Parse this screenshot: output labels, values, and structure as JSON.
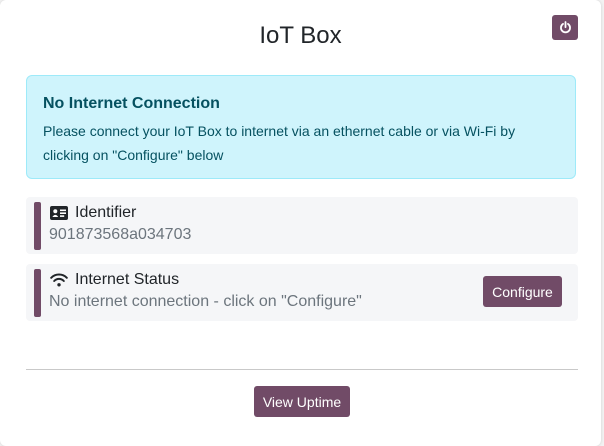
{
  "header": {
    "title": "IoT Box",
    "power_icon": "power-icon"
  },
  "alert": {
    "heading": "No Internet Connection",
    "body": "Please connect your IoT Box to internet via an ethernet cable or via Wi-Fi by clicking on \"Configure\" below"
  },
  "identifier": {
    "icon": "id-card-icon",
    "label": "Identifier",
    "value": "901873568a034703"
  },
  "internet_status": {
    "icon": "wifi-icon",
    "label": "Internet Status",
    "value": "No internet connection - click on \"Configure\"",
    "button_label": "Configure"
  },
  "footer": {
    "uptime_button_label": "View Uptime"
  },
  "colors": {
    "brand": "#714b67",
    "alert_bg": "#cff4fc",
    "alert_text": "#055160",
    "row_bg": "#f5f6f8"
  }
}
